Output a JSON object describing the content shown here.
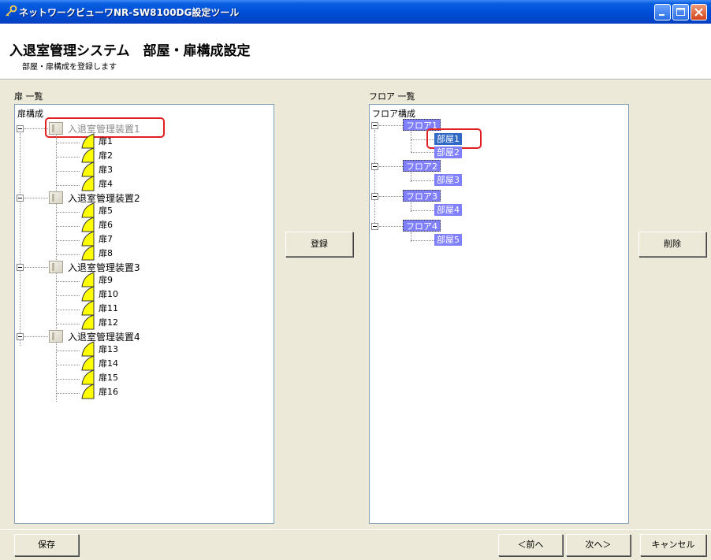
{
  "window": {
    "title": "ネットワークビューワNR-SW8100DG設定ツール"
  },
  "header": {
    "title": "入退室管理システム　部屋・扉構成設定",
    "subtitle": "部屋・扉構成を登録します"
  },
  "left_panel": {
    "label": "扉 一覧",
    "root_label": "扉構成",
    "devices": [
      {
        "label": "入退室管理装置1",
        "doors": [
          "扉1",
          "扉2",
          "扉3",
          "扉4"
        ]
      },
      {
        "label": "入退室管理装置2",
        "doors": [
          "扉5",
          "扉6",
          "扉7",
          "扉8"
        ]
      },
      {
        "label": "入退室管理装置3",
        "doors": [
          "扉9",
          "扉10",
          "扉11",
          "扉12"
        ]
      },
      {
        "label": "入退室管理装置4",
        "doors": [
          "扉13",
          "扉14",
          "扉15",
          "扉16"
        ]
      }
    ]
  },
  "right_panel": {
    "label": "フロア 一覧",
    "root_label": "フロア構成",
    "floors": [
      {
        "label": "フロア1",
        "rooms": [
          "部屋1",
          "部屋2"
        ]
      },
      {
        "label": "フロア2",
        "rooms": [
          "部屋3"
        ]
      },
      {
        "label": "フロア3",
        "rooms": [
          "部屋4"
        ]
      },
      {
        "label": "フロア4",
        "rooms": [
          "部屋5"
        ]
      }
    ]
  },
  "buttons": {
    "register": "登録",
    "delete": "削除",
    "save": "保存",
    "prev": "＜前へ",
    "next": "次へ＞",
    "cancel": "キャンセル"
  },
  "colors": {
    "title_bar": "#0050d8",
    "node_highlight": "#8080ff",
    "selected": "#316ac5",
    "door_icon": "#ffff00",
    "annotation": "#e02020"
  },
  "icons": {
    "title": "key-icon",
    "door": "door-icon",
    "device": "device-icon"
  }
}
